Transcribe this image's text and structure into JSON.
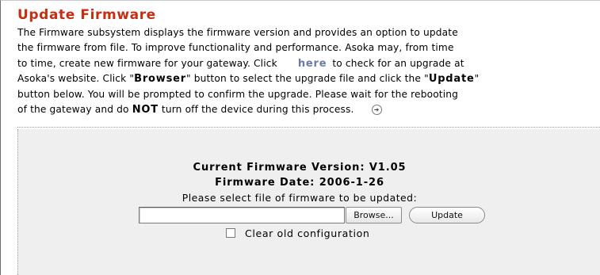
{
  "page": {
    "title": "Update Firmware",
    "intro_line1": "The Firmware subsystem displays the firmware version and provides an option to update",
    "intro_line2": "the firmware from file. To improve functionality and performance. Asoka may, from time",
    "intro_line3_a": "to time, create new firmware for your gateway. Click",
    "here_link": "here",
    "intro_line3_b": "to check for an upgrade at",
    "intro_line4_a": "Asoka's website. Click \"",
    "browser_word": "Browser",
    "intro_line4_b": "\" button to select the upgrade file and click the \"",
    "update_word": "Update",
    "intro_line4_c": "\"",
    "intro_line5": "button below. You will be prompted to confirm the upgrade.  Please wait for the rebooting",
    "intro_line6_a": "of the gateway and do",
    "not_word": "NOT",
    "intro_line6_b": "turn off the device during this process.",
    "more_icon": "arrow-circle-icon",
    "accent_color": "#c62d11",
    "link_color": "#6a79a8"
  },
  "firmware": {
    "version_text": "Current Firmware Version: V1.05",
    "date_text": "Firmware Date:  2006-1-26",
    "select_prompt": "Please select file of firmware to be updated:",
    "file_value": "",
    "browse_label": "Browse...",
    "update_label": "Update",
    "clear_config_label": "Clear old configuration",
    "clear_config_checked": false
  }
}
